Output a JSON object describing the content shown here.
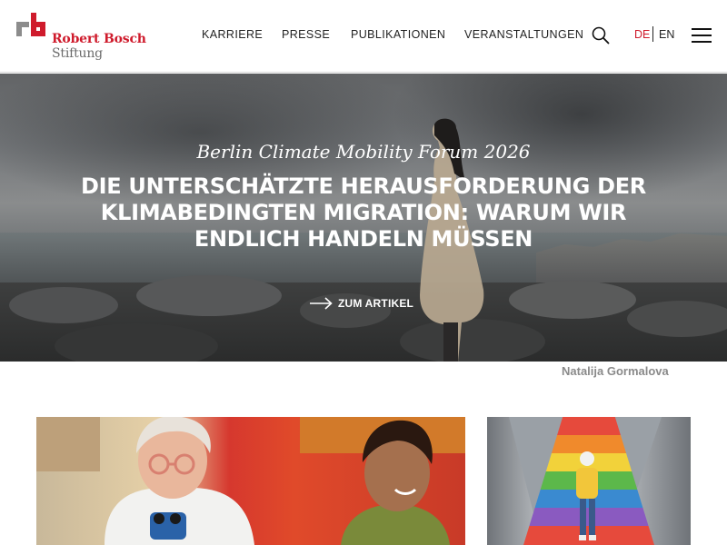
{
  "brand": {
    "name_line1": "Robert Bosch",
    "name_line2": "Stiftung",
    "accent_color": "#cf1b2c"
  },
  "nav": {
    "items": [
      {
        "label": "KARRIERE"
      },
      {
        "label": "PRESSE"
      },
      {
        "label": "PUBLIKATIONEN"
      },
      {
        "label": "VERANSTALTUNGEN"
      }
    ],
    "search_icon": "search-icon",
    "menu_icon": "hamburger-menu-icon"
  },
  "language": {
    "active": "DE",
    "other": "EN"
  },
  "hero": {
    "overline": "Berlin Climate Mobility Forum 2026",
    "title": "DIE UNTERSCHÄTZTE HERAUSFORDERUNG DER KLIMABEDINGTEN MIGRATION: WARUM WIR ENDLICH HANDELN MÜSSEN",
    "link_label": "ZUM ARTIKEL",
    "link_icon": "arrow-right-icon",
    "photo_credit": "Natalija Gormalova"
  },
  "cards": [
    {
      "image": "older-woman-and-girl-photo"
    },
    {
      "image": "rainbow-stairs-photo"
    }
  ]
}
